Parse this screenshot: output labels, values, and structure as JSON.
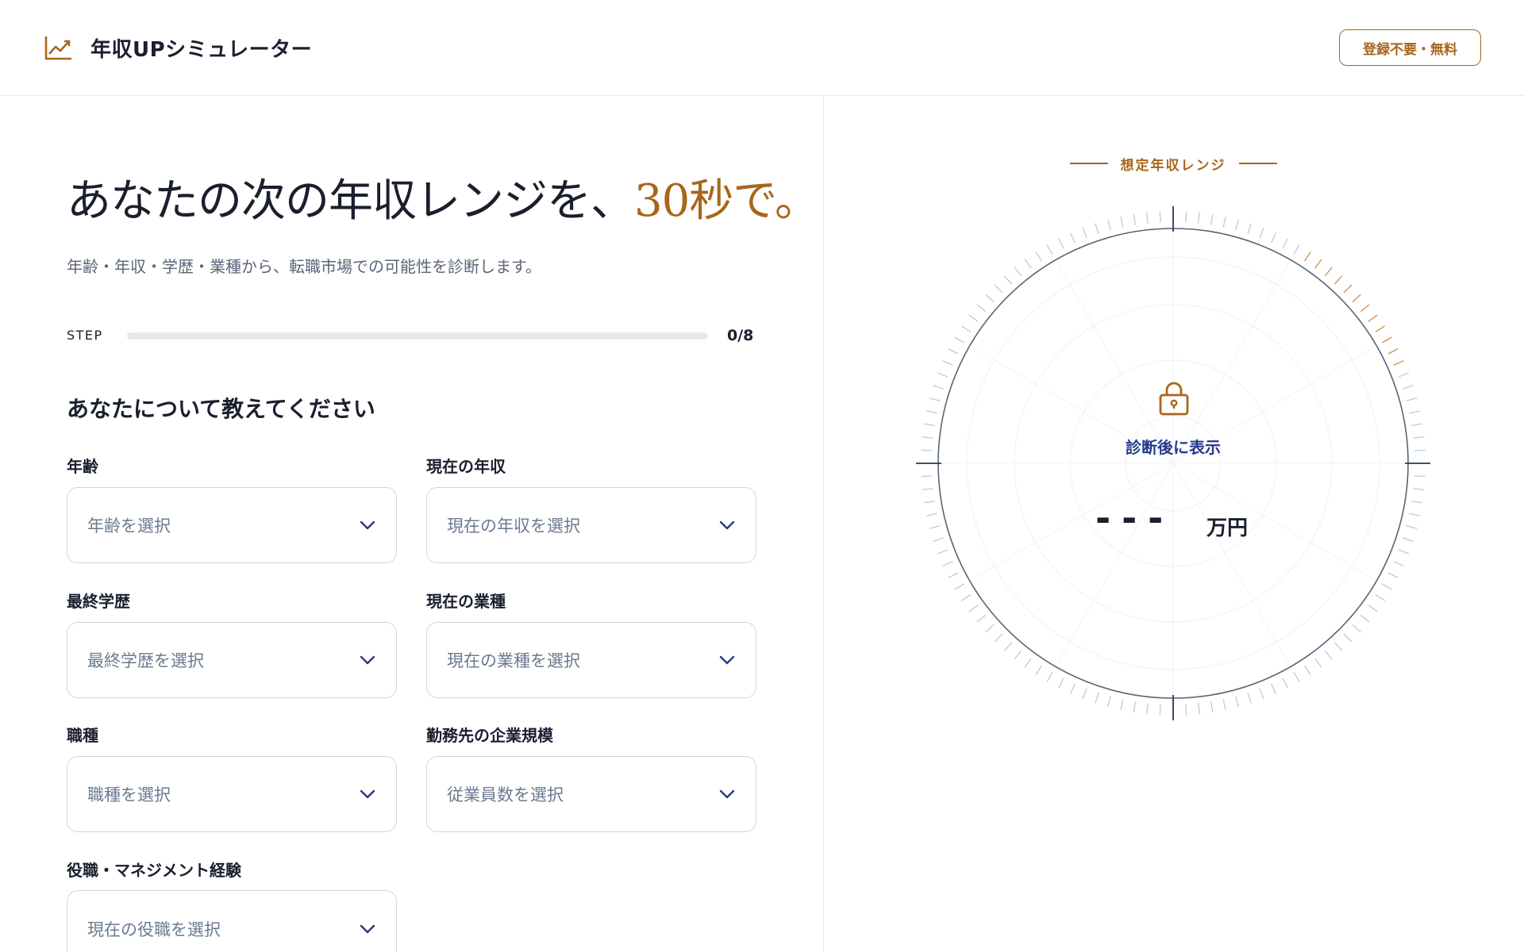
{
  "app": {
    "title": "年収UPシミュレーター",
    "badge": "登録不要・無料"
  },
  "hero": {
    "headline_main": "あなたの次の年収レンジを、",
    "headline_accent": "30秒で。",
    "subtitle": "年齢・年収・学歴・業種から、転職市場での可能性を診断します。"
  },
  "progress": {
    "label": "STEP",
    "current": 0,
    "total": 8,
    "count_text": "0/8",
    "fraction": 0
  },
  "form": {
    "title": "あなたについて教えてください",
    "fields": [
      {
        "label": "年齢",
        "placeholder": "年齢を選択"
      },
      {
        "label": "現在の年収",
        "placeholder": "現在の年収を選択"
      },
      {
        "label": "最終学歴",
        "placeholder": "最終学歴を選択"
      },
      {
        "label": "現在の業種",
        "placeholder": "現在の業種を選択"
      },
      {
        "label": "職種",
        "placeholder": "職種を選択"
      },
      {
        "label": "勤務先の企業規模",
        "placeholder": "従業員数を選択"
      },
      {
        "label": "役職・マネジメント経験",
        "placeholder": "現在の役職を選択"
      }
    ]
  },
  "gauge": {
    "title": "想定年収レンジ",
    "hint": "診断後に表示",
    "value": "---",
    "unit": "万円",
    "icon": "lock-icon"
  },
  "colors": {
    "accent": "#a8661a",
    "navy": "#243a8a",
    "text": "#1a1f2e",
    "muted": "#6b7a90",
    "border": "#cfd6df"
  }
}
